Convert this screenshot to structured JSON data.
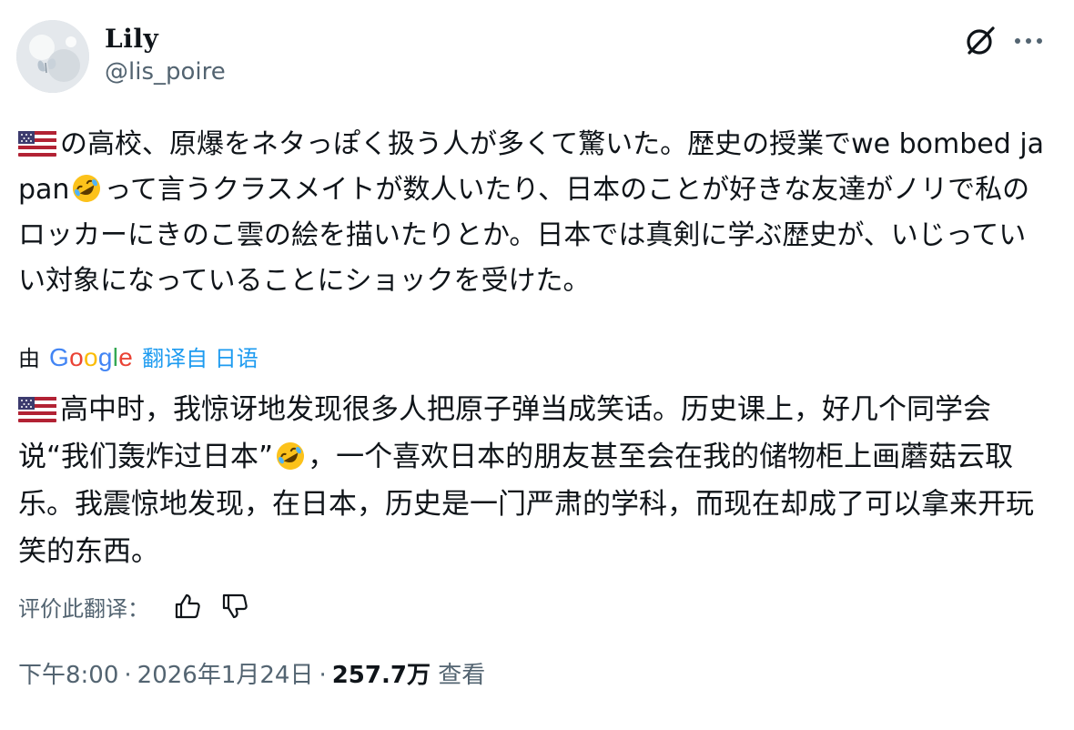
{
  "author": {
    "name": "Lily",
    "handle": "@lis_poire"
  },
  "header_icons": [
    "grok-icon",
    "more-options-icon"
  ],
  "post": {
    "flag": "us-flag-icon",
    "emoji": "rolling-on-floor-laughing-icon",
    "original_part1": "の高校、原爆をネタっぽく扱う人が多くて驚いた。歴史の授業でwe bombed japan",
    "original_part2": "って言うクラスメイトが数人いたり、日本のことが好きな友達がノリで私のロッカーにきのこ雲の絵を描いたりとか。日本では真剣に学ぶ歴史が、いじっていい対象になっていることにショックを受けた。"
  },
  "translation": {
    "by_label": "由",
    "google": [
      "G",
      "o",
      "o",
      "g",
      "l",
      "e"
    ],
    "link_label": "翻译自 日语",
    "text_part1": "高中时，我惊讶地发现很多人把原子弹当成笑话。历史课上，好几个同学会说“我们轰炸过日本”",
    "text_part2": "，一个喜欢日本的朋友甚至会在我的储物柜上画蘑菇云取乐。我震惊地发现，在日本，历史是一门严肃的学科，而现在却成了可以拿来开玩笑的东西。"
  },
  "rating": {
    "label": "评价此翻译："
  },
  "meta": {
    "time": "下午8:00",
    "separator": "·",
    "date": "2026年1月24日",
    "views_count": "257.7万",
    "views_label": "查看"
  },
  "colors": {
    "text": "#0f1419",
    "secondary": "#536471",
    "link": "#1d9bf0",
    "google_blue": "#4285f4",
    "google_red": "#ea4335",
    "google_yellow": "#fbbc05",
    "google_green": "#34a853"
  }
}
